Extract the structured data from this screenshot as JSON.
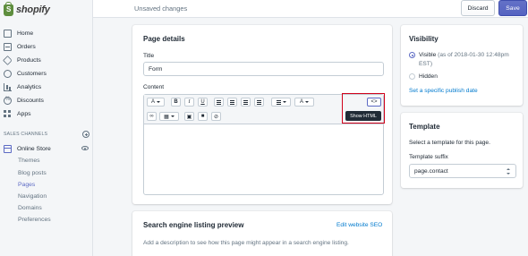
{
  "brand": {
    "logo_text": "shopify"
  },
  "sidebar": {
    "items": [
      {
        "label": "Home",
        "icon": "home-icon"
      },
      {
        "label": "Orders",
        "icon": "orders-icon"
      },
      {
        "label": "Products",
        "icon": "products-icon"
      },
      {
        "label": "Customers",
        "icon": "customers-icon"
      },
      {
        "label": "Analytics",
        "icon": "analytics-icon"
      },
      {
        "label": "Discounts",
        "icon": "discounts-icon"
      },
      {
        "label": "Apps",
        "icon": "apps-icon"
      }
    ],
    "sales_channels_header": "SALES CHANNELS",
    "channel": {
      "label": "Online Store",
      "icon": "online-store-icon"
    },
    "sub_items": [
      "Themes",
      "Blog posts",
      "Pages",
      "Navigation",
      "Domains",
      "Preferences"
    ],
    "active_sub_item": "Pages"
  },
  "topbar": {
    "status": "Unsaved changes",
    "discard_label": "Discard",
    "save_label": "Save"
  },
  "page_details": {
    "title": "Page details",
    "title_label": "Title",
    "title_value": "Form",
    "content_label": "Content",
    "toolbar": {
      "paragraph": "A",
      "bold": "B",
      "italic": "I",
      "underline": "U",
      "text_color": "A",
      "show_html": "<>",
      "show_html_tooltip": "Show HTML"
    }
  },
  "seo": {
    "title": "Search engine listing preview",
    "edit_link": "Edit website SEO",
    "description": "Add a description to see how this page might appear in a search engine listing."
  },
  "visibility": {
    "title": "Visibility",
    "visible_label": "Visible",
    "visible_note_line1": "(as of 2018-01-30 12:48pm",
    "visible_note_line2": "EST)",
    "hidden_label": "Hidden",
    "publish_link": "Set a specific publish date"
  },
  "template": {
    "title": "Template",
    "description": "Select a template for this page.",
    "suffix_label": "Template suffix",
    "suffix_value": "page.contact"
  },
  "colors": {
    "accent": "#5c6ac4",
    "link": "#007ace",
    "highlight": "#d0021b"
  }
}
